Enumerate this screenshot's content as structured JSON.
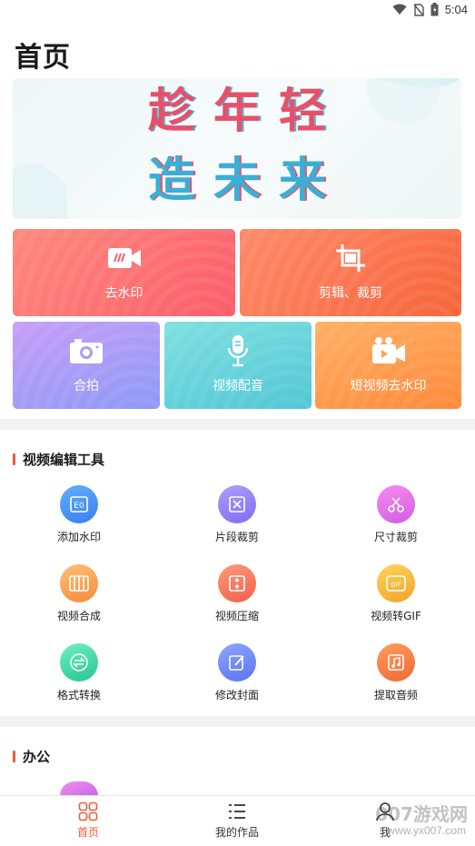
{
  "status_bar": {
    "time": "5:04"
  },
  "page_title": "首页",
  "banner": {
    "line1": "趁年轻",
    "line2": "造未来"
  },
  "tiles": [
    {
      "label": "去水印",
      "icon": "video-watermark-icon"
    },
    {
      "label": "剪辑、裁剪",
      "icon": "crop-icon"
    },
    {
      "label": "合拍",
      "icon": "camera-icon"
    },
    {
      "label": "视频配音",
      "icon": "microphone-icon"
    },
    {
      "label": "短视频去水印",
      "icon": "clapper-icon"
    }
  ],
  "sections": {
    "video_tools": {
      "title": "视频编辑工具",
      "items": [
        {
          "label": "添加水印",
          "icon": "add-watermark-icon",
          "color": "#4a90f5"
        },
        {
          "label": "片段裁剪",
          "icon": "clip-cut-icon",
          "color": "#8f7ef5"
        },
        {
          "label": "尺寸裁剪",
          "icon": "size-cut-icon",
          "color": "#e766e0"
        },
        {
          "label": "视频合成",
          "icon": "video-merge-icon",
          "color": "#f7a04a"
        },
        {
          "label": "视频压缩",
          "icon": "video-compress-icon",
          "color": "#f7775a"
        },
        {
          "label": "视频转GIF",
          "icon": "gif-icon",
          "color": "#f5b73a"
        },
        {
          "label": "格式转换",
          "icon": "format-convert-icon",
          "color": "#3fd0a5"
        },
        {
          "label": "修改封面",
          "icon": "edit-cover-icon",
          "color": "#6d86f5"
        },
        {
          "label": "提取音频",
          "icon": "extract-audio-icon",
          "color": "#f57b4a"
        }
      ]
    },
    "office": {
      "title": "办公"
    }
  },
  "bottom_nav": [
    {
      "label": "首页",
      "icon": "home-grid-icon",
      "active": true
    },
    {
      "label": "我的作品",
      "icon": "list-icon",
      "active": false
    },
    {
      "label": "我",
      "icon": "profile-icon",
      "active": false
    }
  ],
  "watermark": {
    "brand": "007游戏网",
    "url": "www.yx007.com"
  },
  "colors": {
    "accent": "#f25c35",
    "active_nav": "#f25c35",
    "inactive_nav": "#333333"
  }
}
